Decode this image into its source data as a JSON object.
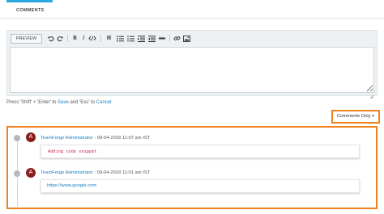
{
  "tabs": [
    {
      "label": "COMMENTS",
      "active": true
    }
  ],
  "editor": {
    "preview_label": "PREVIEW",
    "toolbar_icons": [
      "undo-icon",
      "redo-icon",
      "bold-icon",
      "italic-icon",
      "code-icon",
      "heading-icon",
      "bullet-list-icon",
      "numbered-list-icon",
      "indent-icon",
      "outdent-icon",
      "horizontal-rule-icon",
      "link-icon",
      "image-icon"
    ],
    "toolbar_text": {
      "bold": "B",
      "italic": "I",
      "heading": "H"
    },
    "value": ""
  },
  "hint": {
    "prefix": "Press 'Shift' + 'Enter' to ",
    "save": "Save",
    "middle": " and 'Esc' to ",
    "cancel": "Cancel"
  },
  "filter": {
    "label": "Comments Only",
    "caret": "▾"
  },
  "comments": [
    {
      "avatar_letter": "A",
      "author": "TeamForge Administrator",
      "timestamp": " : 09-04-2018 11:07 am IST",
      "body": "Adding code snippet"
    },
    {
      "avatar_letter": "A",
      "author": "TeamForge Administrator",
      "timestamp": " : 09-04-2018 11:01 am IST",
      "body": "https://www.google.com"
    }
  ],
  "colors": {
    "accent": "#29a8df",
    "highlight": "#f0821e",
    "avatar": "#8b1c1c",
    "link": "#1d7fc1",
    "code": "#c7254e"
  }
}
